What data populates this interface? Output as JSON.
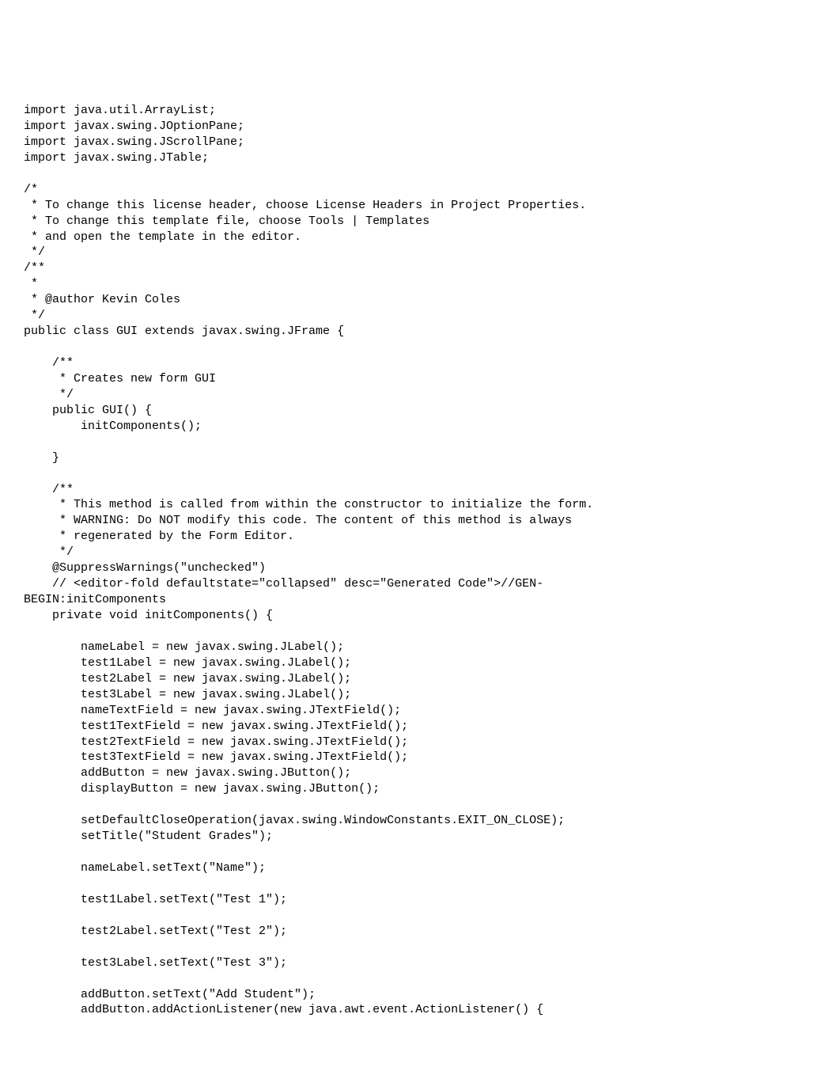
{
  "code": {
    "lines": [
      "import java.util.ArrayList;",
      "import javax.swing.JOptionPane;",
      "import javax.swing.JScrollPane;",
      "import javax.swing.JTable;",
      "",
      "/*",
      " * To change this license header, choose License Headers in Project Properties.",
      " * To change this template file, choose Tools | Templates",
      " * and open the template in the editor.",
      " */",
      "/**",
      " *",
      " * @author Kevin Coles",
      " */",
      "public class GUI extends javax.swing.JFrame {",
      "",
      "    /**",
      "     * Creates new form GUI",
      "     */",
      "    public GUI() {",
      "        initComponents();",
      "",
      "    }",
      "",
      "    /**",
      "     * This method is called from within the constructor to initialize the form.",
      "     * WARNING: Do NOT modify this code. The content of this method is always",
      "     * regenerated by the Form Editor.",
      "     */",
      "    @SuppressWarnings(\"unchecked\")",
      "    // <editor-fold defaultstate=\"collapsed\" desc=\"Generated Code\">//GEN-",
      "BEGIN:initComponents",
      "    private void initComponents() {",
      "",
      "        nameLabel = new javax.swing.JLabel();",
      "        test1Label = new javax.swing.JLabel();",
      "        test2Label = new javax.swing.JLabel();",
      "        test3Label = new javax.swing.JLabel();",
      "        nameTextField = new javax.swing.JTextField();",
      "        test1TextField = new javax.swing.JTextField();",
      "        test2TextField = new javax.swing.JTextField();",
      "        test3TextField = new javax.swing.JTextField();",
      "        addButton = new javax.swing.JButton();",
      "        displayButton = new javax.swing.JButton();",
      "",
      "        setDefaultCloseOperation(javax.swing.WindowConstants.EXIT_ON_CLOSE);",
      "        setTitle(\"Student Grades\");",
      "",
      "        nameLabel.setText(\"Name\");",
      "",
      "        test1Label.setText(\"Test 1\");",
      "",
      "        test2Label.setText(\"Test 2\");",
      "",
      "        test3Label.setText(\"Test 3\");",
      "",
      "        addButton.setText(\"Add Student\");",
      "        addButton.addActionListener(new java.awt.event.ActionListener() {"
    ]
  }
}
